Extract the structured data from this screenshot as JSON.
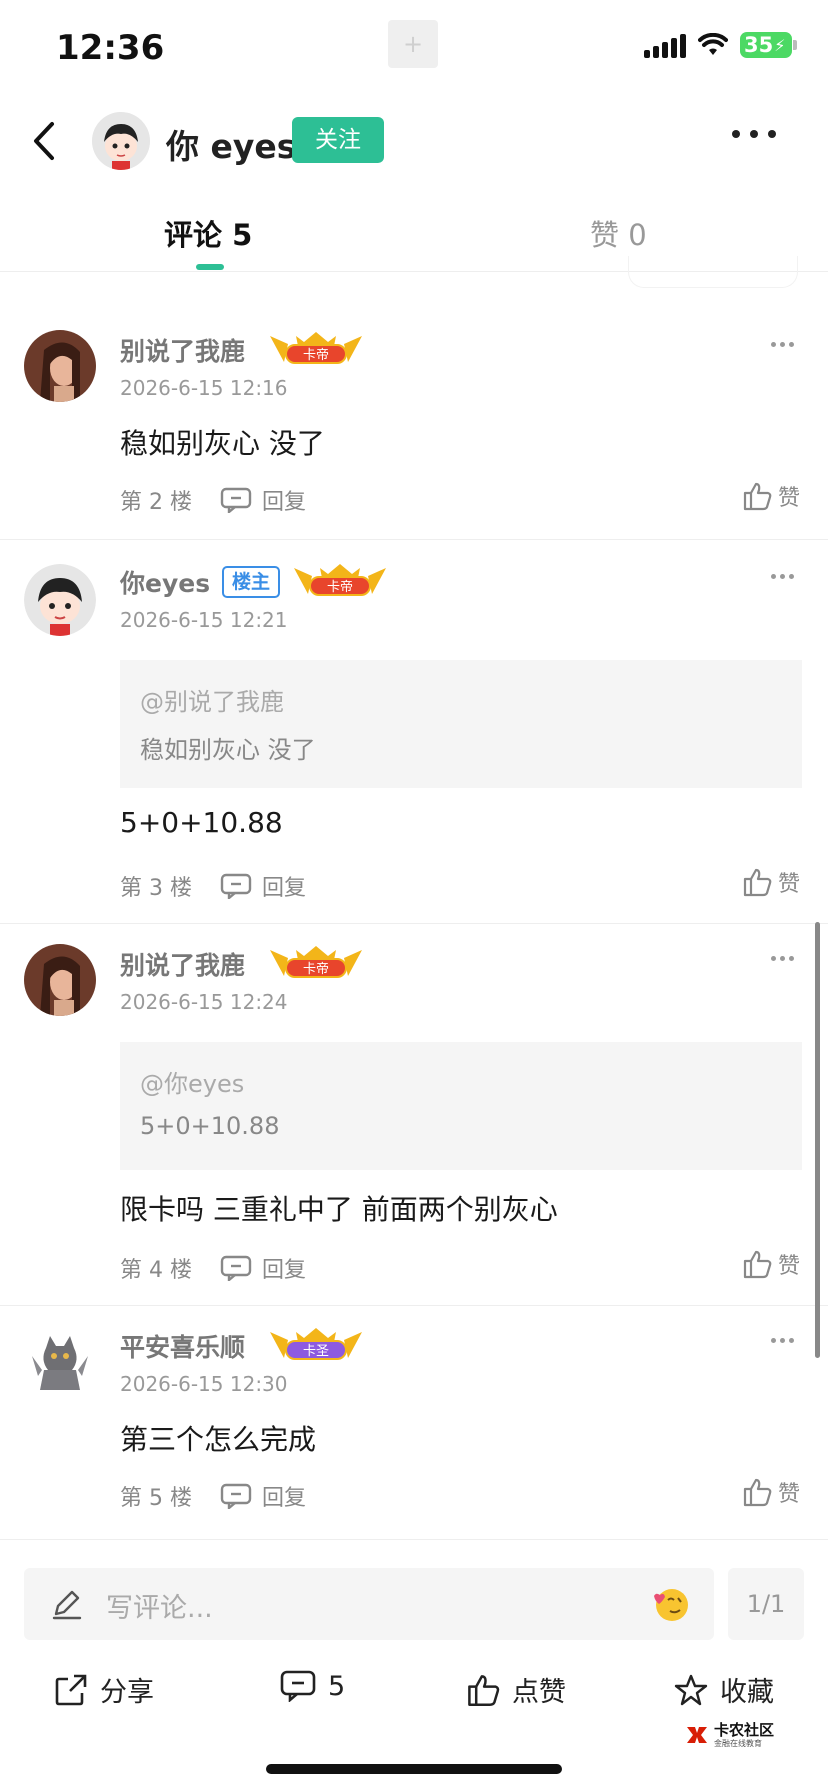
{
  "status": {
    "time": "12:36",
    "battery": "35"
  },
  "post": {
    "author": "你 eyes",
    "follow_label": "关注",
    "tabs": [
      {
        "label": "评论 5",
        "active": true
      },
      {
        "label": "赞 0",
        "active": false
      }
    ]
  },
  "comments": [
    {
      "name": "别说了我鹿",
      "badge": "卡帝",
      "time": "2026-6-15 12:16",
      "text": "稳如别灰心 没了",
      "floor": "第 2 楼",
      "reply": "回复",
      "like": "赞"
    },
    {
      "name": "你eyes",
      "host_label": "楼主",
      "badge": "卡帝",
      "time": "2026-6-15 12:21",
      "quote_at": "@别说了我鹿",
      "quote_text": "稳如别灰心 没了",
      "text": "5+0+10.88",
      "floor": "第 3 楼",
      "reply": "回复",
      "like": "赞"
    },
    {
      "name": "别说了我鹿",
      "badge": "卡帝",
      "time": "2026-6-15 12:24",
      "quote_at": "@你eyes",
      "quote_text": "5+0+10.88",
      "text": "限卡吗 三重礼中了 前面两个别灰心",
      "floor": "第 4 楼",
      "reply": "回复",
      "like": "赞"
    },
    {
      "name": "平安喜乐顺",
      "badge": "卡圣",
      "time": "2026-6-15 12:30",
      "text": "第三个怎么完成",
      "floor": "第 5 楼",
      "reply": "回复",
      "like": "赞"
    }
  ],
  "composer": {
    "placeholder": "写评论...",
    "page": "1/1"
  },
  "actions": {
    "share": "分享",
    "comments": "5",
    "like": "点赞",
    "favorite": "收藏"
  },
  "brand": {
    "name": "卡农社区",
    "sub": "金融在线教育"
  },
  "colors": {
    "accent": "#2dbf95",
    "host_badge": "#3a8ee6",
    "badge_red": "#e8452c",
    "badge_purple": "#8d5ae0",
    "gold": "#f3b519"
  }
}
